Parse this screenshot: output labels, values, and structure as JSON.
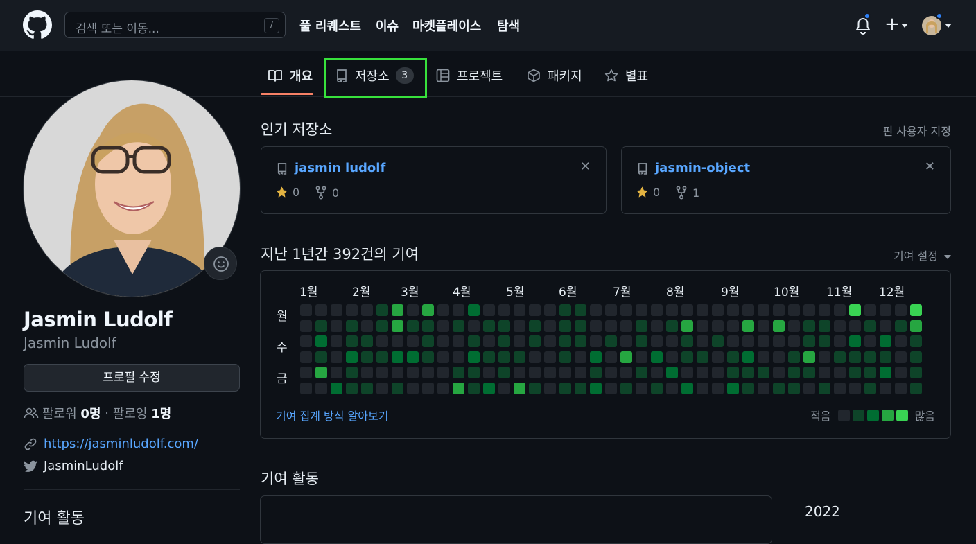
{
  "header": {
    "search_placeholder": "검색 또는 이동...",
    "search_shortcut": "/",
    "nav": [
      "풀 리퀘스트",
      "이슈",
      "마켓플레이스",
      "탐색"
    ],
    "plus_label": "+"
  },
  "tabs": [
    {
      "label": "개요"
    },
    {
      "label": "저장소",
      "count": "3"
    },
    {
      "label": "프로젝트"
    },
    {
      "label": "패키지"
    },
    {
      "label": "별표"
    }
  ],
  "profile": {
    "name": "Jasmin Ludolf",
    "login": "Jasmin Ludolf",
    "edit_button": "프로필 수정",
    "followers_label": "팔로워",
    "followers_count": "0명",
    "separator": "·",
    "following_label": "팔로잉",
    "following_count": "1명",
    "website": "https://jasminludolf.com/",
    "twitter": "JasminLudolf",
    "sidebar_heading": "기여 활동"
  },
  "pinned": {
    "title": "인기 저장소",
    "customize": "핀 사용자 지정",
    "repos": [
      {
        "name": "jasmin ludolf",
        "stars": "0",
        "forks": "0"
      },
      {
        "name": "jasmin-object",
        "stars": "0",
        "forks": "1"
      }
    ]
  },
  "contributions": {
    "title": "지난 1년간 392건의 기여",
    "settings": "기여 설정",
    "months": [
      "1월",
      "2월",
      "3월",
      "4월",
      "5월",
      "6월",
      "7월",
      "8월",
      "9월",
      "10월",
      "11월",
      "12월"
    ],
    "days": [
      "월",
      "수",
      "금"
    ],
    "learn": "기여 집계 방식 알아보기",
    "less": "적음",
    "more": "많음",
    "levels": [
      0,
      1,
      2,
      3,
      4
    ],
    "weeks": 41,
    "grid": [
      "00000130300200000110000000000000000040004",
      "01010131101011010110001013000303011001013",
      "02011000100101010110101001010000011020201",
      "01021122100211100102030201101200130111101",
      "03010000001101000001001020001110110011201",
      "00211010003120310112010102002101101001001"
    ],
    "colors": {
      "0": "#21262d",
      "1": "#0e4429",
      "2": "#006d32",
      "3": "#26a641",
      "4": "#39d353"
    }
  },
  "activity": {
    "title": "기여 활동",
    "year": "2022"
  },
  "accent": {
    "link": "#58a6ff",
    "tab_underline": "#f78166",
    "highlight": "#38e13c",
    "notification": "#2f81f7"
  }
}
